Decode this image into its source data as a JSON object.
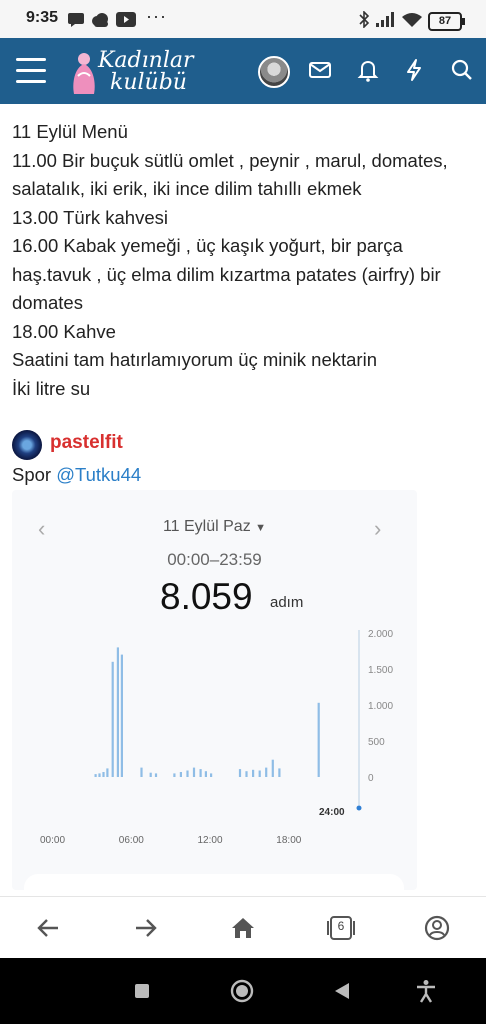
{
  "status_bar": {
    "time": "9:35",
    "battery": "87"
  },
  "header": {
    "logo_line1": "Kadınlar",
    "logo_line2": "kulübü"
  },
  "post": {
    "lines": [
      "11 Eylül Menü",
      "11.00 Bir buçuk sütlü omlet , peynir , marul, domates, salatalık, iki erik, iki ince dilim tahıllı ekmek",
      "13.00 Türk kahvesi",
      "16.00 Kabak yemeği , üç kaşık yoğurt, bir parça haş.tavuk , üç elma dilim kızartma patates (airfry) bir domates",
      "18.00 Kahve",
      "Saatini tam hatırlamıyorum üç minik nektarin",
      "İki litre su"
    ],
    "username": "pastelfit",
    "spor_label": "Spor",
    "mention": "@Tutku44"
  },
  "step_screenshot": {
    "date": "11 Eylül Paz",
    "range": "00:00–23:59",
    "steps": "8.059",
    "unit": "adım",
    "chart_data": {
      "type": "bar",
      "title": "",
      "x_ticks": [
        "00:00",
        "06:00",
        "12:00",
        "18:00"
      ],
      "y_ticks": [
        "2.000",
        "1.500",
        "1.000",
        "500",
        "0"
      ],
      "end_label": "24:00",
      "ylim": [
        0,
        2000
      ],
      "bars": [
        {
          "hour": 4.0,
          "value": 40
        },
        {
          "hour": 4.3,
          "value": 50
        },
        {
          "hour": 4.6,
          "value": 70
        },
        {
          "hour": 4.9,
          "value": 120
        },
        {
          "hour": 5.3,
          "value": 1600
        },
        {
          "hour": 5.7,
          "value": 1800
        },
        {
          "hour": 6.0,
          "value": 1700
        },
        {
          "hour": 7.5,
          "value": 130
        },
        {
          "hour": 8.2,
          "value": 60
        },
        {
          "hour": 8.6,
          "value": 50
        },
        {
          "hour": 10.0,
          "value": 50
        },
        {
          "hour": 10.5,
          "value": 70
        },
        {
          "hour": 11.0,
          "value": 90
        },
        {
          "hour": 11.5,
          "value": 130
        },
        {
          "hour": 12.0,
          "value": 110
        },
        {
          "hour": 12.4,
          "value": 80
        },
        {
          "hour": 12.8,
          "value": 50
        },
        {
          "hour": 15.0,
          "value": 110
        },
        {
          "hour": 15.5,
          "value": 80
        },
        {
          "hour": 16.0,
          "value": 100
        },
        {
          "hour": 16.5,
          "value": 90
        },
        {
          "hour": 17.0,
          "value": 130
        },
        {
          "hour": 17.5,
          "value": 240
        },
        {
          "hour": 18.0,
          "value": 120
        },
        {
          "hour": 21.0,
          "value": 1030
        }
      ]
    }
  },
  "bottom_nav": {
    "tab_count": "6"
  }
}
